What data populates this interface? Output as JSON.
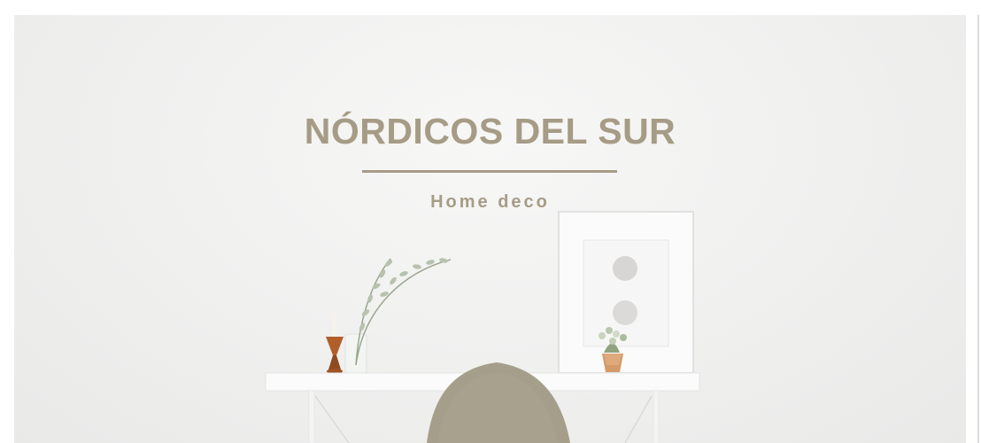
{
  "brand": {
    "title": "NÓRDICOS DEL SUR",
    "subtitle": "Home deco"
  },
  "colors": {
    "accent": "#a69c86",
    "wall": "#f1f1f0",
    "chair": "#a49d89",
    "copper": "#c98b5e",
    "candle_holder": "#b5602c"
  },
  "scene": {
    "objects": [
      "white-desk",
      "grey-shell-chair",
      "candle-holder",
      "eucalyptus-vase",
      "framed-print",
      "potted-plant"
    ]
  }
}
